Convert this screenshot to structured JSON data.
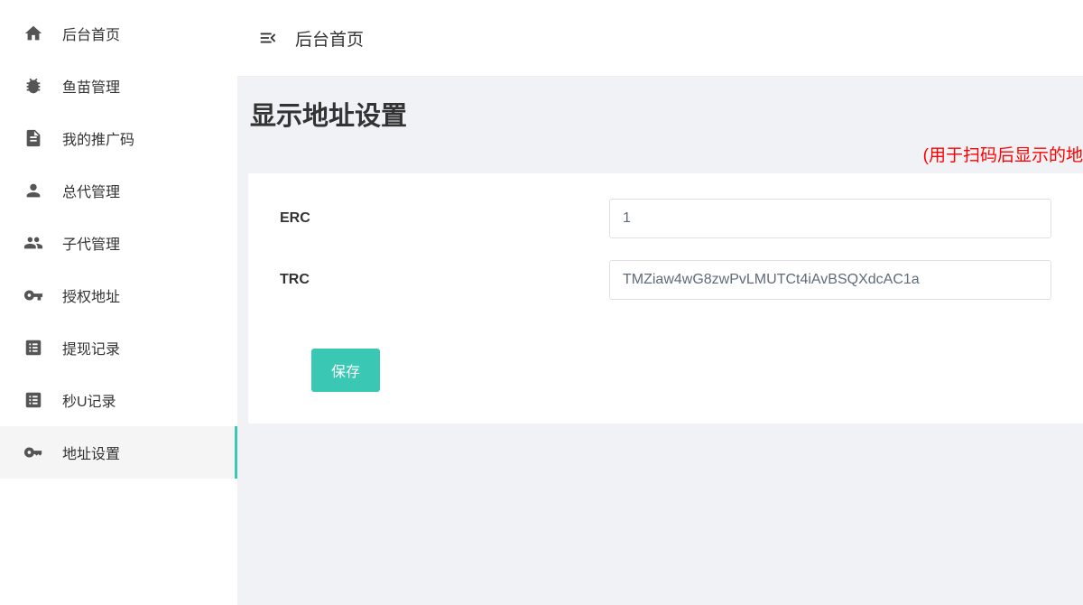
{
  "sidebar": {
    "items": [
      {
        "label": "后台首页",
        "icon": "home"
      },
      {
        "label": "鱼苗管理",
        "icon": "bug"
      },
      {
        "label": "我的推广码",
        "icon": "doc"
      },
      {
        "label": "总代管理",
        "icon": "person"
      },
      {
        "label": "子代管理",
        "icon": "people"
      },
      {
        "label": "授权地址",
        "icon": "key"
      },
      {
        "label": "提现记录",
        "icon": "list"
      },
      {
        "label": "秒U记录",
        "icon": "list"
      },
      {
        "label": "地址设置",
        "icon": "key-settings",
        "active": true
      }
    ]
  },
  "topbar": {
    "title": "后台首页"
  },
  "page": {
    "title": "显示地址设置"
  },
  "notice": "(用于扫码后显示的地",
  "form": {
    "erc": {
      "label": "ERC",
      "value": "1"
    },
    "trc": {
      "label": "TRC",
      "value": "TMZiaw4wG8zwPvLMUTCt4iAvBSQXdcAC1a"
    },
    "save_label": "保存"
  }
}
